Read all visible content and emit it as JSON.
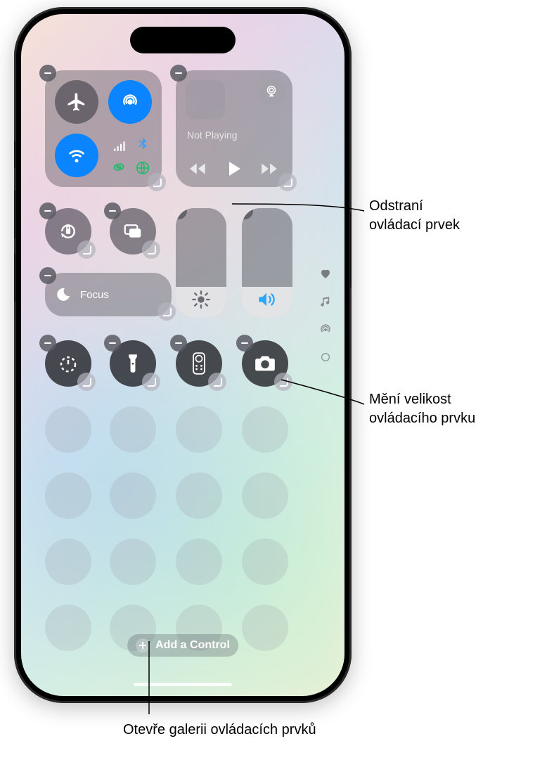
{
  "media": {
    "status": "Not Playing"
  },
  "focus": {
    "label": "Focus"
  },
  "add_control": {
    "label": "Add a Control"
  },
  "callouts": {
    "remove": "Odstraní\novládací prvek",
    "resize": "Mění velikost\novládacího prvku",
    "gallery": "Otevře galerii ovládacích prvků"
  },
  "icons": {
    "airplane": "airplane-icon",
    "airdrop": "airdrop-icon",
    "wifi": "wifi-icon",
    "cellular": "cellular-icon",
    "bluetooth": "bluetooth-icon",
    "hotspot": "personal-hotspot-icon",
    "vpn": "vpn-icon",
    "airplay": "airplay-icon",
    "rewind": "rewind-icon",
    "play": "play-icon",
    "forward": "forward-icon",
    "lock_rotation": "rotation-lock-icon",
    "mirroring": "screen-mirroring-icon",
    "moon": "do-not-disturb-icon",
    "brightness": "brightness-icon",
    "volume": "volume-icon",
    "timer": "timer-icon",
    "flashlight": "flashlight-icon",
    "remote": "apple-tv-remote-icon",
    "camera": "camera-icon",
    "heart": "favorites-page-icon",
    "music_note": "music-page-icon",
    "broadcast": "home-page-icon",
    "ring": "extra-page-icon"
  }
}
